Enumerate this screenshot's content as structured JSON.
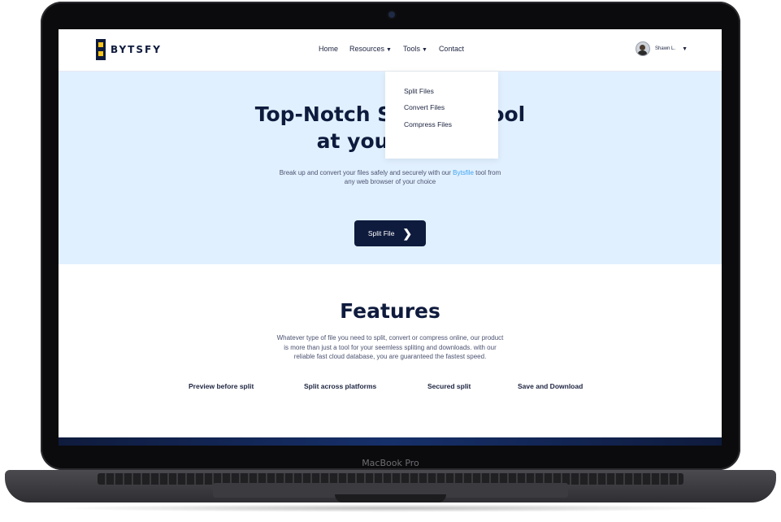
{
  "device": {
    "label": "MacBook Pro"
  },
  "brand": {
    "name": "BYTSFY"
  },
  "nav": {
    "items": [
      {
        "label": "Home"
      },
      {
        "label": "Resources"
      },
      {
        "label": "Tools"
      },
      {
        "label": "Contact"
      }
    ],
    "user": {
      "name": "Shawn L."
    }
  },
  "dropdown": {
    "items": [
      {
        "label": "Split Files"
      },
      {
        "label": "Convert Files"
      },
      {
        "label": "Compress Files"
      }
    ]
  },
  "hero": {
    "title_line1": "Top-Notch S",
    "title_line1_tail": "ool",
    "title_line2": "at your f",
    "subtitle_pre": "Break up and convert your files safely and securely with our ",
    "subtitle_highlight": "Bytsfile",
    "subtitle_post": " tool from",
    "subtitle_line2": "any web browser of your choice",
    "cta_label": "Split File"
  },
  "features": {
    "title": "Features",
    "desc_line1": "Whatever type of file you need to split, convert or compress online, our product",
    "desc_line2": "is more than just a tool for your seemless spliting and downloads. with our",
    "desc_line3": "reliable fast cloud database, you are guaranteed the fastest speed.",
    "items": [
      {
        "label": "Preview before split"
      },
      {
        "label": "Split across platforms"
      },
      {
        "label": "Secured split"
      },
      {
        "label": "Save and Download"
      }
    ]
  },
  "colors": {
    "primary": "#0f1b3d",
    "hero_bg": "#e1f0ff",
    "accent": "#3da4f0",
    "logo_yellow": "#f7c51b"
  }
}
